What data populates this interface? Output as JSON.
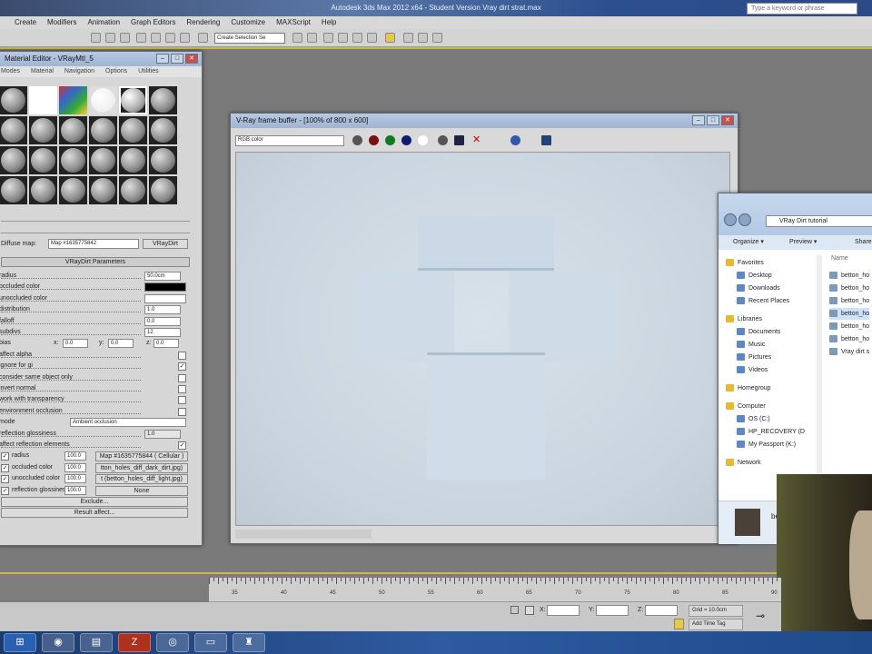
{
  "app": {
    "title": "Autodesk 3ds Max 2012 x64 - Student Version     Vray dirt strat.max",
    "search_placeholder": "Type a keyword or phrase"
  },
  "menu": [
    "Create",
    "Modifiers",
    "Animation",
    "Graph Editors",
    "Rendering",
    "Customize",
    "MAXScript",
    "Help"
  ],
  "toolbar": {
    "selection_set": "Create Selection Se"
  },
  "material_editor": {
    "title": "Material Editor - VRayMtl_5",
    "menu": [
      "Modes",
      "Material",
      "Navigation",
      "Options",
      "Utilities"
    ],
    "map_label": "Diffuse map:",
    "map_name": "Map #1635775842",
    "map_type": "VRayDirt",
    "rollout": "VRayDirt Parameters",
    "params": [
      {
        "label": "radius",
        "value": "50.0cm"
      },
      {
        "label": "occluded color",
        "color": "#000000"
      },
      {
        "label": "unoccluded color",
        "color": "#ffffff"
      },
      {
        "label": "distribution",
        "value": "1.0"
      },
      {
        "label": "falloff",
        "value": "0.0"
      },
      {
        "label": "subdivs",
        "value": "12"
      }
    ],
    "bias": {
      "label": "bias",
      "x": "0.0",
      "y": "0.0",
      "z": "0.0"
    },
    "checks": [
      {
        "label": "affect alpha",
        "checked": false
      },
      {
        "label": "ignore for gi",
        "checked": true
      },
      {
        "label": "consider same object only",
        "checked": false
      },
      {
        "label": "invert normal",
        "checked": false
      },
      {
        "label": "work with transparency",
        "checked": false
      },
      {
        "label": "environment occlusion",
        "checked": false
      }
    ],
    "mode_label": "mode",
    "mode_value": "Ambient occlusion",
    "refl_gloss": {
      "label": "reflection glossiness",
      "value": "1.0"
    },
    "affect_refl": {
      "label": "affect reflection elements",
      "checked": true
    },
    "maps": [
      {
        "label": "radius",
        "amount": "100.0",
        "map": "Map #1635775844 ( Cellular )"
      },
      {
        "label": "occluded color",
        "amount": "100.0",
        "map": "tton_holes_diff_dark_dirt.jpg)"
      },
      {
        "label": "unoccluded color",
        "amount": "100.0",
        "map": "t (betton_holes_diff_light.jpg)"
      },
      {
        "label": "reflection glossiness",
        "amount": "100.0",
        "map": "None"
      }
    ],
    "exclude": "Exclude...",
    "result_affect": "Result affect..."
  },
  "vfb": {
    "title": "V-Ray frame buffer - [100% of 800 x 600]",
    "channel": "RGB color"
  },
  "explorer": {
    "path": "VRay Dirt tutorial",
    "toolbar": [
      "Organize ▾",
      "Preview ▾",
      "Share"
    ],
    "column": "Name",
    "nav": [
      {
        "label": "Favorites",
        "group": true
      },
      {
        "label": "Desktop"
      },
      {
        "label": "Downloads"
      },
      {
        "label": "Recent Places"
      },
      {
        "label": "Libraries",
        "group": true
      },
      {
        "label": "Documents"
      },
      {
        "label": "Music"
      },
      {
        "label": "Pictures"
      },
      {
        "label": "Videos"
      },
      {
        "label": "Homegroup",
        "group": true
      },
      {
        "label": "Computer",
        "group": true
      },
      {
        "label": "OS (C:)"
      },
      {
        "label": "HP_RECOVERY (D"
      },
      {
        "label": "My Passport (K:)"
      },
      {
        "label": "Network",
        "group": true
      }
    ],
    "files": [
      "betton_ho",
      "betton_ho",
      "betton_ho",
      "betton_ho",
      "betton_ho",
      "betton_ho",
      "Vray dirt s"
    ],
    "details": "be"
  },
  "timeline": {
    "ticks": [
      "35",
      "40",
      "45",
      "50",
      "55",
      "60",
      "65",
      "70",
      "75",
      "80",
      "85",
      "90"
    ]
  },
  "status": {
    "x_label": "X:",
    "y_label": "Y:",
    "z_label": "Z:",
    "grid": "Grid = 10.0cm",
    "add_time_tag": "Add Time Tag"
  }
}
